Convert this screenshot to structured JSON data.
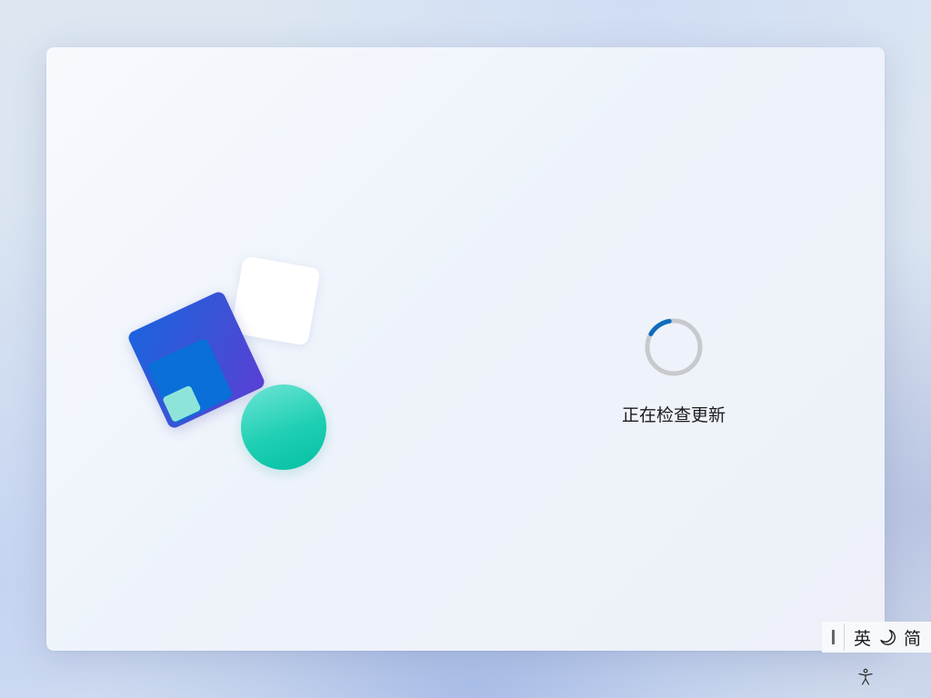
{
  "status": {
    "message": "正在检查更新",
    "spinner_icon": "loading-spinner-icon",
    "spinner_progress": 0.14,
    "spinner_color": "#0f6cbd",
    "spinner_track_color": "#c7c9cd"
  },
  "illustration": {
    "icon": "windows-setup-illustration-icon",
    "colors": {
      "blue_tile": "#3b52d6",
      "inner_tile": "#0a6fd8",
      "mint_chip": "#8fe4d9",
      "teal_circle": "#1fcfb3",
      "white_tile": "#ffffff"
    }
  },
  "ime": {
    "mode_label": "英",
    "theme_icon": "moon-icon",
    "script_label": "简"
  },
  "accessibility": {
    "icon": "accessibility-icon"
  }
}
